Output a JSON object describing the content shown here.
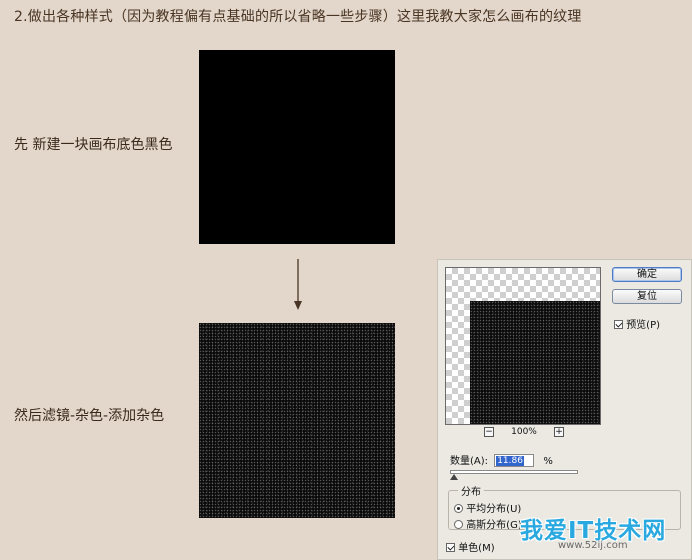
{
  "heading": "2.做出各种样式（因为教程偏有点基础的所以省略一些步骤）这里我教大家怎么画布的纹理",
  "captions": {
    "step1": "先 新建一块画布底色黑色",
    "step2": "然后滤镜-杂色-添加杂色"
  },
  "dialog": {
    "zoom": "100%",
    "zoom_minus": "−",
    "zoom_plus": "+",
    "ok_label": "确定",
    "reset_label": "复位",
    "preview_label": "预览(P)",
    "preview_checked": true,
    "amount_label": "数量(A):",
    "amount_value": "11.86",
    "amount_unit": "%",
    "amount_fraction": 0.0297,
    "distribution_title": "分布",
    "uniform_label": "平均分布(U)",
    "gaussian_label": "高斯分布(G)",
    "uniform_selected": true,
    "mono_label": "单色(M)",
    "mono_checked": true
  },
  "watermark": {
    "title": "我爱IT技术网",
    "url": "www.52ij.com"
  },
  "colors": {
    "page_bg": "#e2d7ca",
    "text": "#3b2a1c",
    "canvas": "#000000",
    "watermark": "#29a9e0"
  }
}
